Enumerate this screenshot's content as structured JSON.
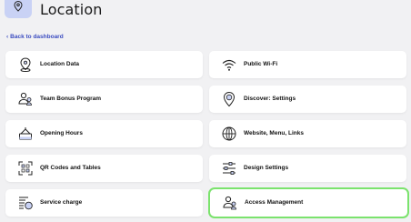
{
  "header": {
    "title": "Location",
    "icon": "location-pin-icon"
  },
  "back_link": {
    "label": "Back to dashboard"
  },
  "cards": [
    {
      "label": "Location Data",
      "icon": "location-pin-icon"
    },
    {
      "label": "Public Wi-Fi",
      "icon": "wifi-icon"
    },
    {
      "label": "Team Bonus Program",
      "icon": "team-users-icon"
    },
    {
      "label": "Discover: Settings",
      "icon": "discover-pin-icon"
    },
    {
      "label": "Opening Hours",
      "icon": "door-bell-icon"
    },
    {
      "label": "Website, Menu, Links",
      "icon": "globe-icon"
    },
    {
      "label": "QR Codes and Tables",
      "icon": "qr-scan-icon"
    },
    {
      "label": "Design Settings",
      "icon": "sliders-icon"
    },
    {
      "label": "Service charge",
      "icon": "receipt-coin-icon"
    },
    {
      "label": "Access Management",
      "icon": "user-access-icon"
    }
  ],
  "colors": {
    "accent": "#3b4cc0",
    "highlight": "#7be36d",
    "header_icon_bg": "#c9d2f5"
  }
}
